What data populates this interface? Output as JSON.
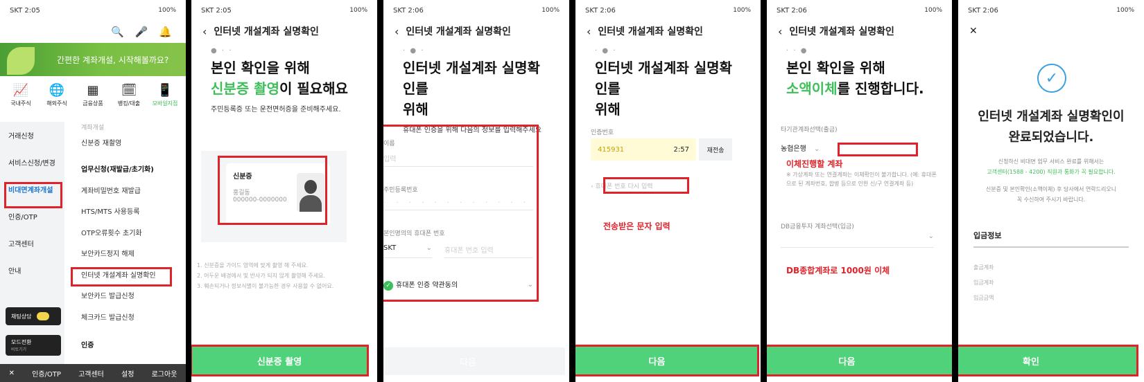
{
  "s1": {
    "status_left": "SKT 2:05",
    "status_right": "100%",
    "banner": "간편한 계좌개설, 시작해볼까요?",
    "menu": [
      {
        "icon": "chart-icon",
        "glyph": "📈",
        "label": "국내주식"
      },
      {
        "icon": "globe-icon",
        "glyph": "🌐",
        "label": "해외주식"
      },
      {
        "icon": "grid-icon",
        "glyph": "▦",
        "label": "금융상품"
      },
      {
        "icon": "calendar-icon",
        "glyph": "🗓",
        "label": "뱅킹/대출"
      },
      {
        "icon": "phone-icon",
        "glyph": "📱",
        "label": "모바일지점"
      }
    ],
    "side": [
      "거래신청",
      "서비스신청/변경",
      "비대면계좌개설",
      "인증/OTP",
      "고객센터",
      "안내"
    ],
    "list_top": [
      "계좌개설",
      "신분증 재촬영"
    ],
    "group": "업무신청(재발급/초기화)",
    "list": [
      "계좌비밀번호 재발급",
      "HTS/MTS 사용등록",
      "OTP오류횟수 초기화",
      "보안카드정지 해제",
      "인터넷 개설계좌 실명확인",
      "보안카드 발급신청",
      "체크카드 발급신청"
    ],
    "group2": "인증",
    "chat": "채팅상담",
    "mode": "모드전환",
    "mode_sub": "비토기기",
    "bottom": [
      "인증/OTP",
      "고객센터",
      "설정",
      "로그아웃"
    ]
  },
  "s2": {
    "status_left": "SKT 2:05",
    "status_right": "100%",
    "title": "인터넷 개설계좌 실명확인",
    "heading1": "본인 확인을 위해",
    "heading2_green": "신분증 촬영",
    "heading2_rest": "이 필요해요",
    "sub": "주민등록증 또는 운전면허증을 준비해주세요.",
    "card_title": "신분증",
    "card_name": "홍길동",
    "card_num": "000000-0000000",
    "notes": [
      "1. 신분증을 가이드 영역에 맞게 촬영 해 주세요.",
      "2. 어두운 배경에서 빛 반사가 되지 않게 촬영해 주세요.",
      "3. 훼손되거나 정보식별이 불가능한 경우 사용할 수 없어요."
    ],
    "button": "신분증 촬영"
  },
  "s3": {
    "status_left": "SKT 2:06",
    "status_right": "100%",
    "title": "인터넷 개설계좌 실명확인",
    "heading1": "인터넷 개설계좌 실명확인를",
    "heading2": "위해",
    "sub": "휴대폰 인증을 위해 다음의 정보를 입력해주세요",
    "name_label": "이름",
    "name_ph": "입력",
    "rrn_label": "주민등록번호",
    "phone_label": "본인명의의 휴대폰 번호",
    "carrier": "SKT",
    "phone_ph": "휴대폰 번호 입력",
    "agree": "휴대폰 인증 약관동의",
    "button": "다음"
  },
  "s4": {
    "status_left": "SKT 2:06",
    "status_right": "100%",
    "title": "인터넷 개설계좌 실명확인",
    "heading1": "인터넷 개설계좌 실명확인를",
    "heading2": "위해",
    "code_label": "인증번호",
    "code": "415931",
    "timer": "2:57",
    "resend": "재전송",
    "retry": "휴대폰 번호 다시 입력",
    "annotation": "전송받은 문자 입력",
    "button": "다음"
  },
  "s5": {
    "status_left": "SKT 2:06",
    "status_right": "100%",
    "title": "인터넷 개설계좌 실명확인",
    "heading1": "본인 확인을 위해",
    "heading2_green": "소액이체",
    "heading2_rest": "를 진행합니다.",
    "bank_label": "타기관계좌선택(출금)",
    "bank": "농협은행",
    "annot1": "이체진행할 계좌",
    "note": "※ 가상계좌 또는 연결계좌는 이체확인이 불가합니다. (예: 휴대폰으로 된 계좌번호, 합병 등으로 인한 신/구 연결계좌 등)",
    "db_label": "DB금융투자 계좌선택(입금)",
    "annot2": "DB종합계좌로 1000원 이체",
    "button": "다음"
  },
  "s6": {
    "status_left": "SKT 2:06",
    "status_right": "100%",
    "heading1": "인터넷 개설계좌 실명확인이",
    "heading2": "완료되었습니다.",
    "line1": "신청하신 비대면 업무 서비스 완료를 위해서는",
    "line2": "고객센터(1588 - 4200) 직원과 통화가 꼭 필요합니다.",
    "line3": "신분증 및 본인확인(소액이체) 후 당사에서 연락드리오니",
    "line4": "꼭 수신하여 주시기 바랍니다.",
    "section": "입금정보",
    "rows": [
      "출금계좌",
      "입금계좌",
      "입금금액"
    ],
    "button": "확인"
  }
}
